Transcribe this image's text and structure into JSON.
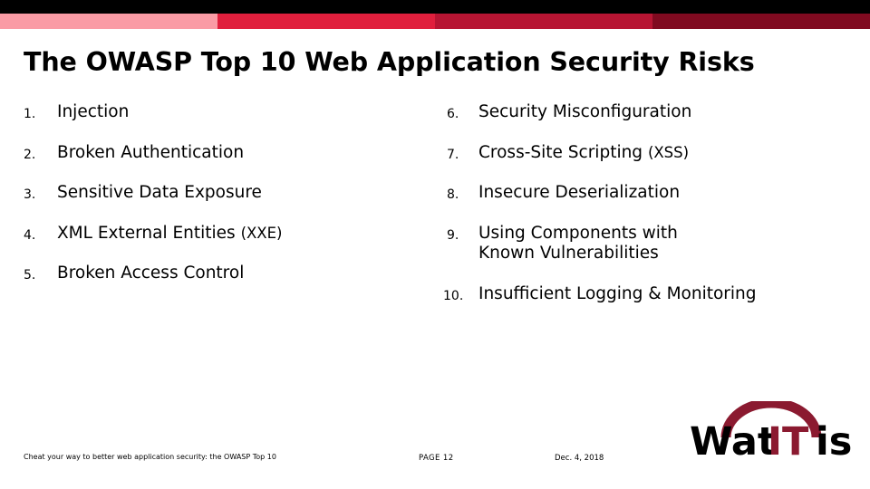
{
  "slide": {
    "title": "The OWASP Top 10 Web Application Security Risks",
    "top_band": {
      "black_color": "#000000",
      "segments": [
        {
          "name": "pale-pink",
          "color": "#FA9BA5"
        },
        {
          "name": "crimson",
          "color": "#E01F3D"
        },
        {
          "name": "dark-crimson",
          "color": "#B71533"
        },
        {
          "name": "maroon",
          "color": "#800A20"
        }
      ]
    }
  },
  "risks_left": [
    {
      "num": "1.",
      "text": "Injection"
    },
    {
      "num": "2.",
      "text": "Broken Authentication"
    },
    {
      "num": "3.",
      "text": "Sensitive Data Exposure"
    },
    {
      "num": "4.",
      "text": "XML External Entities ",
      "abbr": "(XXE)"
    },
    {
      "num": "5.",
      "text": "Broken Access Control"
    }
  ],
  "risks_right": [
    {
      "num": "6.",
      "text": "Security Misconfiguration"
    },
    {
      "num": "7.",
      "text": "Cross-Site Scripting ",
      "abbr": "(XSS)"
    },
    {
      "num": "8.",
      "text": "Insecure Deserialization"
    },
    {
      "num": "9.",
      "text": "Using Components with Known Vulnerabilities"
    },
    {
      "num": "10.",
      "text": "Insufficient Logging & Monitoring"
    }
  ],
  "footer": {
    "note": "Cheat your way to better web application security: the OWASP Top 10",
    "page": "PAGE  12",
    "date": "Dec. 4, 2018"
  },
  "logo": {
    "part_wat": "Wat",
    "part_it": "IT",
    "part_is": "is",
    "arc_color": "#8B1A30",
    "it_color": "#8B1A30",
    "text_color": "#000000"
  }
}
